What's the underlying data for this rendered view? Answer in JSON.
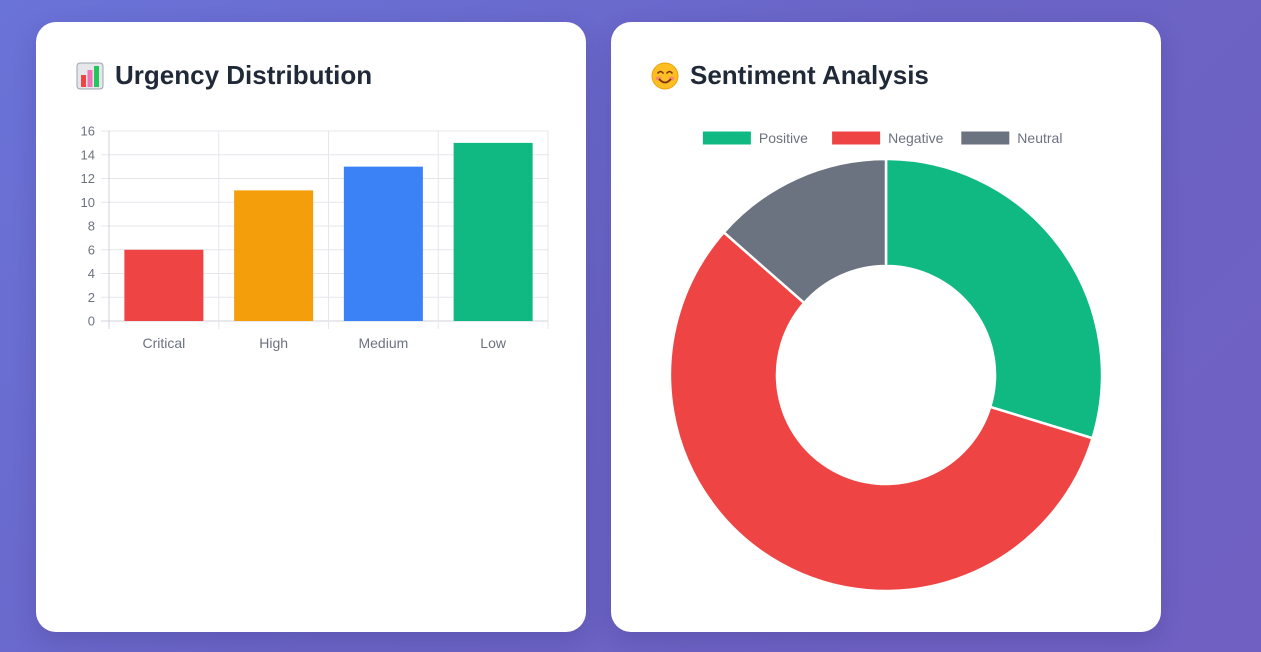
{
  "cards": {
    "urgency": {
      "title": "Urgency Distribution",
      "icon": "bar-chart-emoji-icon"
    },
    "sentiment": {
      "title": "Sentiment Analysis",
      "icon": "smiling-face-emoji-icon"
    }
  },
  "chart_data": [
    {
      "type": "bar",
      "title": "Urgency Distribution",
      "categories": [
        "Critical",
        "High",
        "Medium",
        "Low"
      ],
      "values": [
        6,
        11,
        13,
        15
      ],
      "colors": [
        "#ef4444",
        "#f59e0b",
        "#3b82f6",
        "#10b981"
      ],
      "yticks": [
        "0",
        "2",
        "4",
        "6",
        "8",
        "10",
        "12",
        "14",
        "16"
      ],
      "ylim": [
        0,
        16
      ],
      "grid": true,
      "legend": "none"
    },
    {
      "type": "pie",
      "variant": "doughnut",
      "title": "Sentiment Analysis",
      "labels": [
        "Positive",
        "Negative",
        "Neutral"
      ],
      "values": [
        11,
        21,
        5
      ],
      "colors": [
        "#10b981",
        "#ef4444",
        "#6b7280"
      ],
      "legend": "top"
    }
  ]
}
